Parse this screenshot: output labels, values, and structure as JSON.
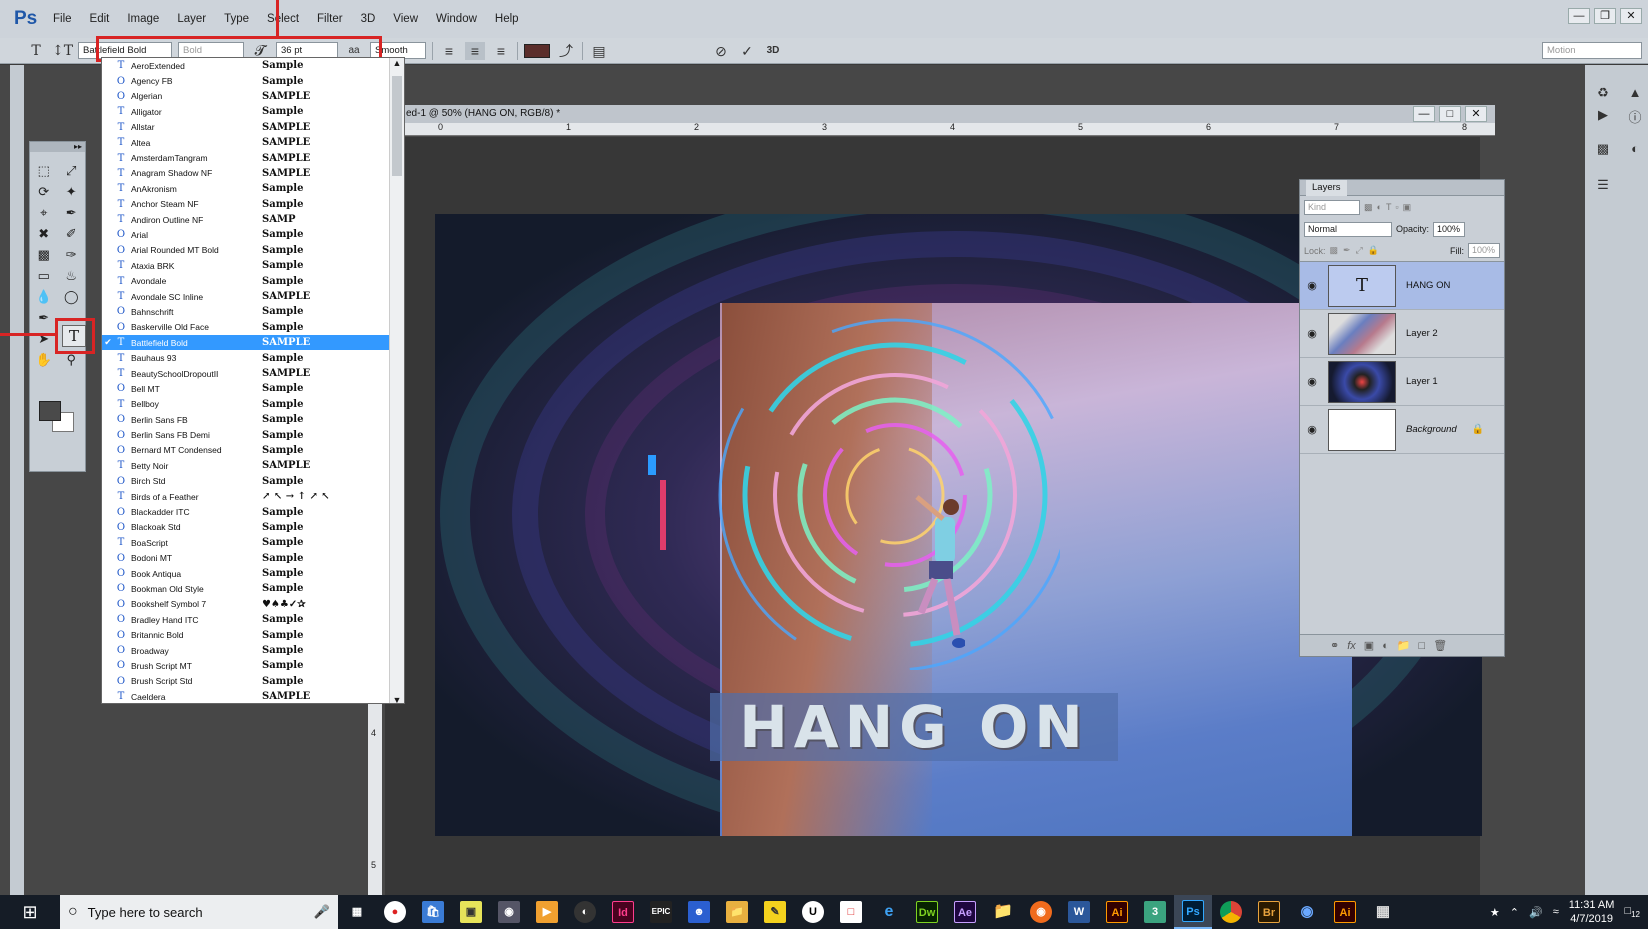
{
  "app": {
    "logo": "Ps"
  },
  "menu": [
    "File",
    "Edit",
    "Image",
    "Layer",
    "Type",
    "Select",
    "Filter",
    "3D",
    "View",
    "Window",
    "Help"
  ],
  "options_bar": {
    "font_family": "Battlefield Bold",
    "font_style": "Bold",
    "font_size": "36 pt",
    "antialias": "Smooth",
    "workspace": "Motion",
    "text_color": "#5b2e2b"
  },
  "document": {
    "tab_title": "ed-1 @ 50% (HANG ON, RGB/8) *",
    "ruler_labels": [
      "0",
      "1",
      "2",
      "3",
      "4",
      "5",
      "6",
      "7",
      "8"
    ],
    "ruler_left_labels": [
      "4",
      "5"
    ],
    "canvas_text": "HANG ON"
  },
  "font_list": [
    {
      "icon": "T",
      "name": "AeroExtended",
      "sample": "Sample"
    },
    {
      "icon": "O",
      "name": "Agency FB",
      "sample": "Sample"
    },
    {
      "icon": "O",
      "name": "Algerian",
      "sample": "SAMPLE"
    },
    {
      "icon": "T",
      "name": "Alligator",
      "sample": "Sample"
    },
    {
      "icon": "T",
      "name": "Allstar",
      "sample": "SAMPLE"
    },
    {
      "icon": "T",
      "name": "Altea",
      "sample": "SAMPLE"
    },
    {
      "icon": "T",
      "name": "AmsterdamTangram",
      "sample": "SAMPLE"
    },
    {
      "icon": "T",
      "name": "Anagram Shadow NF",
      "sample": "SAMPLE"
    },
    {
      "icon": "T",
      "name": "AnAkronism",
      "sample": "Sample"
    },
    {
      "icon": "T",
      "name": "Anchor Steam NF",
      "sample": "Sample"
    },
    {
      "icon": "T",
      "name": "Andiron Outline NF",
      "sample": "SAMP"
    },
    {
      "icon": "O",
      "name": "Arial",
      "sample": "Sample"
    },
    {
      "icon": "O",
      "name": "Arial Rounded MT Bold",
      "sample": "Sample"
    },
    {
      "icon": "T",
      "name": "Ataxia BRK",
      "sample": "Sample"
    },
    {
      "icon": "T",
      "name": "Avondale",
      "sample": "Sample"
    },
    {
      "icon": "T",
      "name": "Avondale SC Inline",
      "sample": "SAMPLE"
    },
    {
      "icon": "O",
      "name": "Bahnschrift",
      "sample": "Sample"
    },
    {
      "icon": "O",
      "name": "Baskerville Old Face",
      "sample": "Sample"
    },
    {
      "icon": "T",
      "name": "Battlefield Bold",
      "sample": "SAMPLE",
      "selected": true
    },
    {
      "icon": "T",
      "name": "Bauhaus 93",
      "sample": "Sample"
    },
    {
      "icon": "T",
      "name": "BeautySchoolDropoutII",
      "sample": "SAMPLE"
    },
    {
      "icon": "O",
      "name": "Bell MT",
      "sample": "Sample"
    },
    {
      "icon": "T",
      "name": "Bellboy",
      "sample": "Sample"
    },
    {
      "icon": "O",
      "name": "Berlin Sans FB",
      "sample": "Sample"
    },
    {
      "icon": "O",
      "name": "Berlin Sans FB Demi",
      "sample": "Sample"
    },
    {
      "icon": "O",
      "name": "Bernard MT Condensed",
      "sample": "Sample"
    },
    {
      "icon": "T",
      "name": "Betty Noir",
      "sample": "SAMPLE"
    },
    {
      "icon": "O",
      "name": "Birch Std",
      "sample": "Sample"
    },
    {
      "icon": "T",
      "name": "Birds of a Feather",
      "sample": "↗ ↖ → ↑ ↗ ↖"
    },
    {
      "icon": "O",
      "name": "Blackadder ITC",
      "sample": "Sample"
    },
    {
      "icon": "O",
      "name": "Blackoak Std",
      "sample": "Sample"
    },
    {
      "icon": "T",
      "name": "BoaScript",
      "sample": "Sample"
    },
    {
      "icon": "O",
      "name": "Bodoni MT",
      "sample": "Sample"
    },
    {
      "icon": "O",
      "name": "Book Antiqua",
      "sample": "Sample"
    },
    {
      "icon": "O",
      "name": "Bookman Old Style",
      "sample": "Sample"
    },
    {
      "icon": "O",
      "name": "Bookshelf Symbol 7",
      "sample": "♥♠♣✓✰"
    },
    {
      "icon": "O",
      "name": "Bradley Hand ITC",
      "sample": "Sample"
    },
    {
      "icon": "O",
      "name": "Britannic Bold",
      "sample": "Sample"
    },
    {
      "icon": "O",
      "name": "Broadway",
      "sample": "Sample"
    },
    {
      "icon": "O",
      "name": "Brush Script MT",
      "sample": "Sample"
    },
    {
      "icon": "O",
      "name": "Brush Script Std",
      "sample": "Sample"
    },
    {
      "icon": "T",
      "name": "Caeldera",
      "sample": "SAMPLE"
    }
  ],
  "layers_panel": {
    "title": "Layers",
    "filter_kind": "Kind",
    "blend_mode": "Normal",
    "opacity_label": "Opacity:",
    "opacity_value": "100%",
    "lock_label": "Lock:",
    "fill_label": "Fill:",
    "fill_value": "100%",
    "layers": [
      {
        "name": "HANG ON",
        "type": "text",
        "active": true
      },
      {
        "name": "Layer 2",
        "type": "image"
      },
      {
        "name": "Layer 1",
        "type": "image"
      },
      {
        "name": "Background",
        "type": "background",
        "locked": true
      }
    ]
  },
  "taskbar": {
    "search_placeholder": "Type here to search",
    "apps": [
      "Id",
      "EPIC",
      "Dw",
      "Ae",
      "W",
      "Ai",
      "3",
      "Ps",
      "Br",
      "Ai"
    ],
    "time": "11:31 AM",
    "date": "4/7/2019",
    "notif_count": "12"
  }
}
